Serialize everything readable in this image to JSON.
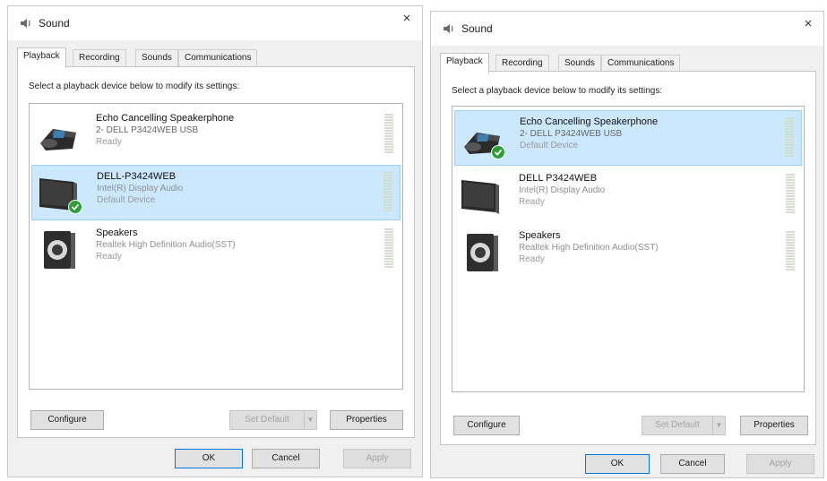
{
  "dialogs": [
    {
      "title": "Sound",
      "close_glyph": "×",
      "tabs": [
        "Playback",
        "Recording",
        "Sounds",
        "Communications"
      ],
      "instruction": "Select a playback device below to modify its settings:",
      "devices": [
        {
          "name": "Echo Cancelling Speakerphone",
          "description": "2- DELL P3424WEB USB",
          "status": "Ready",
          "icon": "speakerphone-icon",
          "selected": false,
          "default": false
        },
        {
          "name": "DELL-P3424WEB",
          "description": "Intel(R) Display Audio",
          "status": "Default Device",
          "icon": "monitor-icon",
          "selected": true,
          "default": true
        },
        {
          "name": "Speakers",
          "description": "Realtek High Definition Audio(SST)",
          "status": "Ready",
          "icon": "speaker-icon",
          "selected": false,
          "default": false
        }
      ],
      "buttons": {
        "configure": "Configure",
        "set_default": "Set Default",
        "properties": "Properties",
        "ok": "OK",
        "cancel": "Cancel",
        "apply": "Apply"
      }
    },
    {
      "title": "Sound",
      "close_glyph": "×",
      "tabs": [
        "Playback",
        "Recording",
        "Sounds",
        "Communications"
      ],
      "instruction": "Select a playback device below to modify its settings:",
      "devices": [
        {
          "name": "Echo Cancelling Speakerphone",
          "description": "2- DELL P3424WEB USB",
          "status": "Default Device",
          "icon": "speakerphone-icon",
          "selected": true,
          "default": true
        },
        {
          "name": "DELL P3424WEB",
          "description": "Intel(R) Display Audio",
          "status": "Ready",
          "icon": "monitor-icon",
          "selected": false,
          "default": false
        },
        {
          "name": "Speakers",
          "description": "Realtek High Definition Audio(SST)",
          "status": "Ready",
          "icon": "speaker-icon",
          "selected": false,
          "default": false
        }
      ],
      "buttons": {
        "configure": "Configure",
        "set_default": "Set Default",
        "properties": "Properties",
        "ok": "OK",
        "cancel": "Cancel",
        "apply": "Apply"
      }
    }
  ],
  "colors": {
    "selection": "#cce8ff",
    "selection_border": "#99d1ff",
    "default_check": "#2f9e39",
    "dialog_bg": "#f0f0f0",
    "accent": "#0078d7"
  }
}
